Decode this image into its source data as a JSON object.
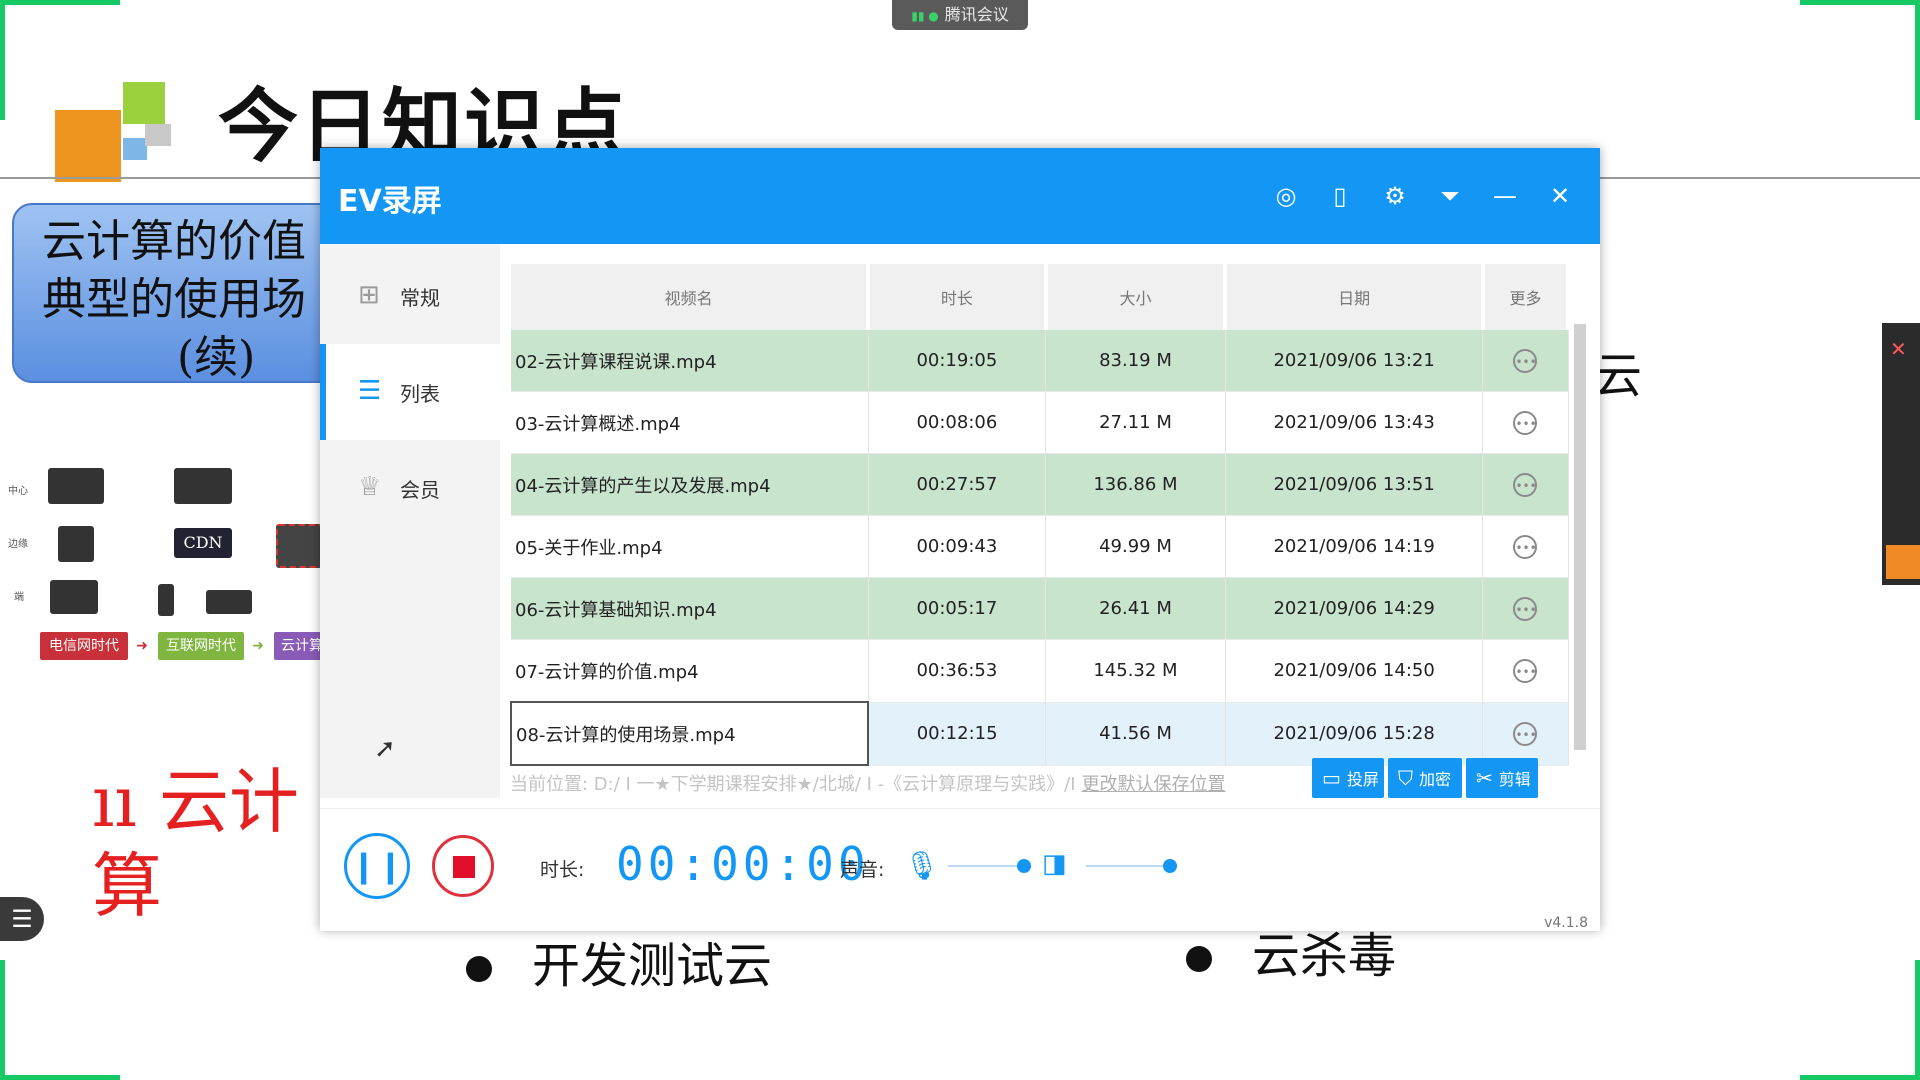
{
  "meeting": {
    "label": "腾讯会议"
  },
  "slide": {
    "title": "今日知识点",
    "box_lines": [
      "云计算的价值",
      "典型的使用场",
      "(续)"
    ],
    "diagram_rows": [
      "中心",
      "边缘",
      "端"
    ],
    "diagram_cdn": "CDN",
    "eras": [
      "电信网时代",
      "互联网时代",
      "云计算"
    ],
    "partial_text": "云",
    "bullets": [
      "开发测试云",
      "云杀毒"
    ],
    "handwriting": "ıı 云计算"
  },
  "ev": {
    "title": "EV录屏",
    "titlebar_icons": [
      "user-icon",
      "phone-icon",
      "gear-icon",
      "dropdown-icon",
      "minimize-icon",
      "close-icon"
    ],
    "nav": [
      {
        "label": "常规",
        "icon": "grid-icon"
      },
      {
        "label": "列表",
        "icon": "list-icon"
      },
      {
        "label": "会员",
        "icon": "crown-icon"
      }
    ],
    "table": {
      "headers": [
        "视频名",
        "时长",
        "大小",
        "日期",
        "更多"
      ],
      "rows": [
        {
          "name": "02-云计算课程说课.mp4",
          "duration": "00:19:05",
          "size": "83.19 M",
          "date": "2021/09/06 13:21"
        },
        {
          "name": "03-云计算概述.mp4",
          "duration": "00:08:06",
          "size": "27.11 M",
          "date": "2021/09/06 13:43"
        },
        {
          "name": "04-云计算的产生以及发展.mp4",
          "duration": "00:27:57",
          "size": "136.86 M",
          "date": "2021/09/06 13:51"
        },
        {
          "name": "05-关于作业.mp4",
          "duration": "00:09:43",
          "size": "49.99 M",
          "date": "2021/09/06 14:19"
        },
        {
          "name": "06-云计算基础知识.mp4",
          "duration": "00:05:17",
          "size": "26.41 M",
          "date": "2021/09/06 14:29"
        },
        {
          "name": "07-云计算的价值.mp4",
          "duration": "00:36:53",
          "size": "145.32 M",
          "date": "2021/09/06 14:50"
        },
        {
          "name": "08-云计算的使用场景.mp4",
          "duration": "00:12:15",
          "size": "41.56 M",
          "date": "2021/09/06 15:28"
        }
      ]
    },
    "path": {
      "text": "当前位置: D:/ I 一★下学期课程安排★/北城/ I -《云计算原理与实践》/I",
      "change_link": "更改默认保存位置"
    },
    "actions": {
      "cast": "投屏",
      "encrypt": "加密",
      "edit": "剪辑"
    },
    "bottom": {
      "duration_label": "时长:",
      "duration_value": "00:00:00",
      "volume_label": "声音:",
      "mic_level": 0.9,
      "speaker_level": 1.0
    },
    "version": "v4.1.8"
  },
  "colors": {
    "accent": "#1497f4",
    "row_highlight": "#c9e4cd",
    "stop": "#e0102c",
    "corner": "#17c964"
  }
}
